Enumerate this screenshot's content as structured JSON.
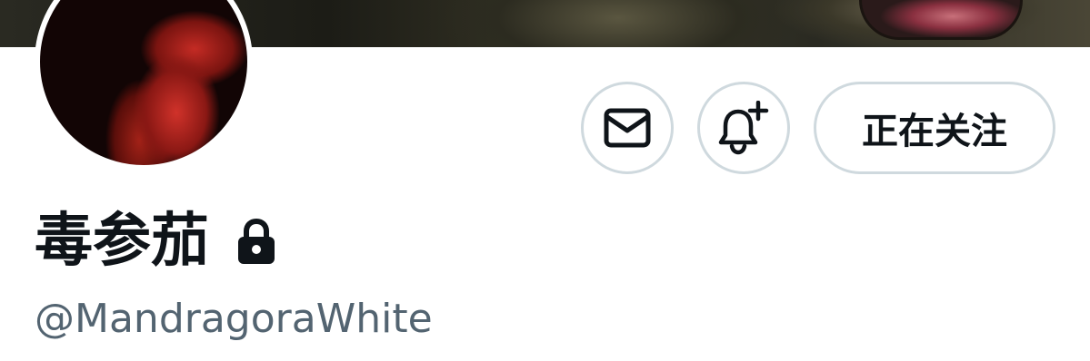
{
  "profile": {
    "display_name": "毒参茄",
    "handle": "@MandragoraWhite",
    "is_protected": true
  },
  "actions": {
    "message_icon": "envelope-icon",
    "notify_icon": "bell-plus-icon",
    "follow_label": "正在关注"
  },
  "colors": {
    "text_primary": "#0f1419",
    "text_secondary": "#536471",
    "button_border": "#cfd9de",
    "background": "#ffffff"
  }
}
